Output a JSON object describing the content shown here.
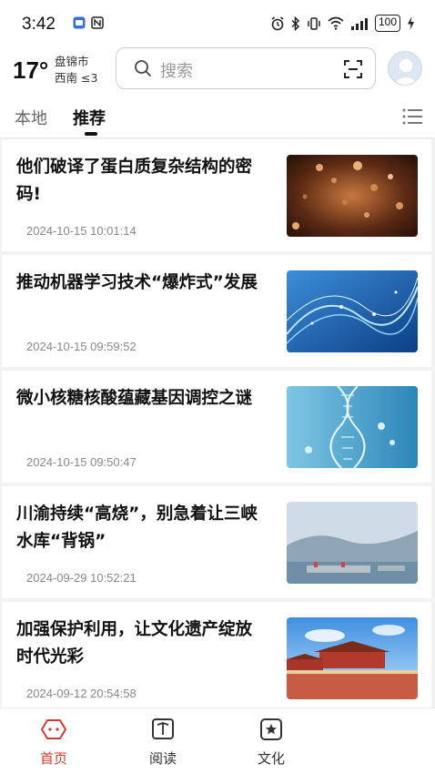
{
  "status_bar": {
    "time": "3:42",
    "battery": "100"
  },
  "weather": {
    "temperature": "17°",
    "city": "盘锦市",
    "wind": "西南 ≤3"
  },
  "search": {
    "placeholder": "搜索"
  },
  "tabs": [
    {
      "label": "本地"
    },
    {
      "label": "推荐"
    }
  ],
  "articles": [
    {
      "title": "他们破译了蛋白质复杂结构的密码!",
      "time": "2024-10-15 10:01:14"
    },
    {
      "title": "推动机器学习技术“爆炸式”发展",
      "time": "2024-10-15 09:59:52"
    },
    {
      "title": "微小核糖核酸蕴藏基因调控之谜",
      "time": "2024-10-15 09:50:47"
    },
    {
      "title": "川渝持续“高烧”，别急着让三峡水库“背锅”",
      "time": "2024-09-29 10:52:21"
    },
    {
      "title": "加强保护利用，让文化遗产绽放时代光彩",
      "time": "2024-09-12 20:54:58"
    }
  ],
  "bottom_nav": [
    {
      "label": "首页"
    },
    {
      "label": "阅读"
    },
    {
      "label": "文化"
    }
  ],
  "colors": {
    "accent": "#d23a2e"
  }
}
